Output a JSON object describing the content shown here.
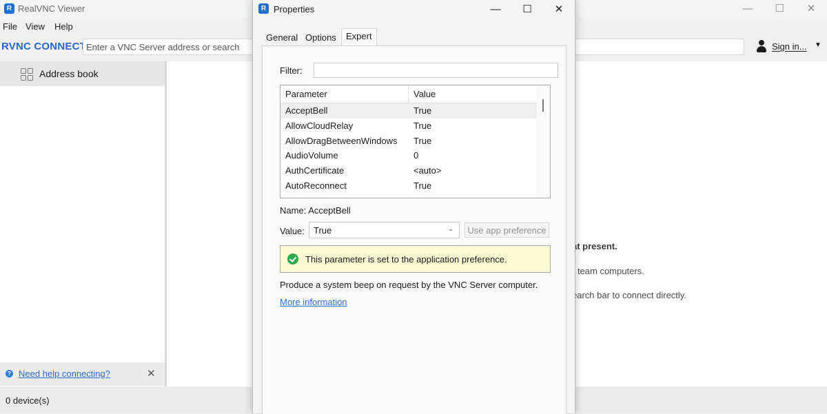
{
  "main_window": {
    "title": "RealVNC Viewer",
    "icon_letter": "R",
    "controls": {
      "minimize": "—",
      "maximize": "☐",
      "close": "✕"
    },
    "menu": [
      {
        "label": "File"
      },
      {
        "label": "View"
      },
      {
        "label": "Help"
      }
    ],
    "brand": "RVNC CONNECT",
    "search": {
      "placeholder": "Enter a VNC Server address or search",
      "value": ""
    },
    "sign_in": {
      "label": "Sign in...",
      "caret": "▼"
    },
    "sidebar": {
      "items": [
        {
          "label": "Address book"
        }
      ],
      "help_link": "Need help connecting?",
      "help_icon": "?",
      "help_close": "✕"
    },
    "content_hints": [
      "at present.",
      "r team computers.",
      "earch bar to connect directly."
    ],
    "status": {
      "device_count": "0 device(s)"
    }
  },
  "dialog": {
    "title": "Properties",
    "icon_letter": "R",
    "controls": {
      "minimize": "—",
      "maximize": "☐",
      "close": "✕"
    },
    "tabs": [
      {
        "label": "General",
        "active": false
      },
      {
        "label": "Options",
        "active": false
      },
      {
        "label": "Expert",
        "active": true
      }
    ],
    "filter": {
      "label": "Filter:",
      "value": ""
    },
    "table": {
      "headers": {
        "parameter": "Parameter",
        "value": "Value"
      },
      "rows": [
        {
          "name": "AcceptBell",
          "value": "True",
          "selected": true
        },
        {
          "name": "AllowCloudRelay",
          "value": "True"
        },
        {
          "name": "AllowDragBetweenWindows",
          "value": "True"
        },
        {
          "name": "AudioVolume",
          "value": "0"
        },
        {
          "name": "AuthCertificate",
          "value": "<auto>"
        },
        {
          "name": "AutoReconnect",
          "value": "True"
        }
      ]
    },
    "name_field": {
      "label": "Name:",
      "value": "AcceptBell"
    },
    "value_field": {
      "label": "Value:",
      "selected": "True",
      "caret": "⌄"
    },
    "use_app_preference": "Use app preference",
    "info_message": "This parameter is set to the application preference.",
    "description": "Produce a system beep on request by the VNC Server computer.",
    "more_info_link": "More information"
  },
  "colors": {
    "accent": "#2b64c8",
    "link": "#2b6cd1",
    "info_bg": "#fbfbd3",
    "check_green": "#2fa84f"
  }
}
